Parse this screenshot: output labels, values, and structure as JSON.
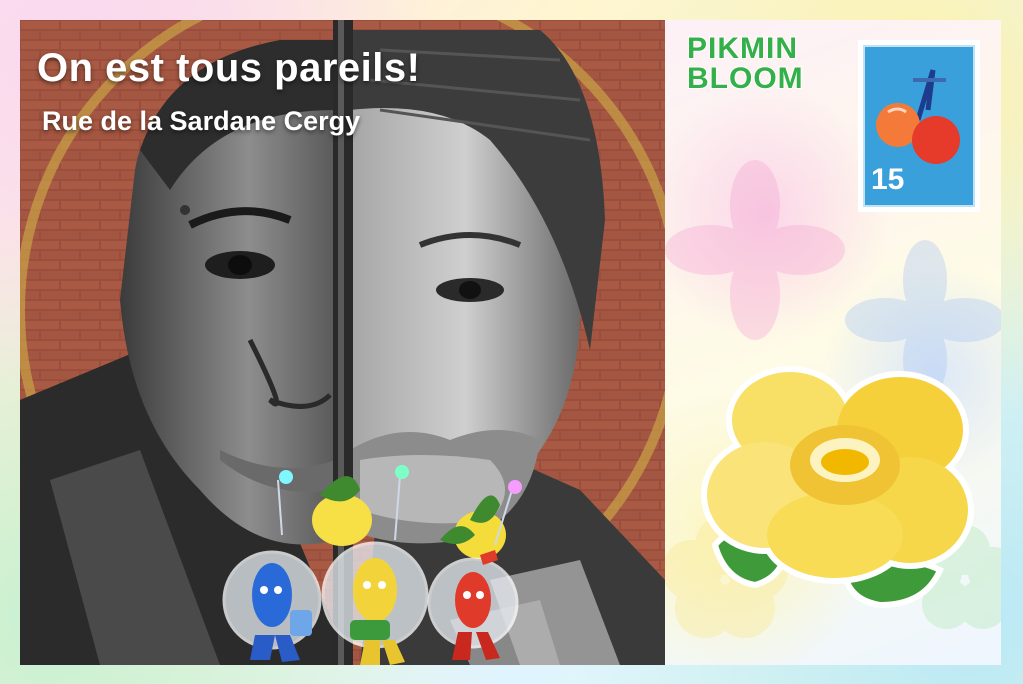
{
  "postcard": {
    "title": "On est tous pareils!",
    "location": "Rue de la Sardane Cergy"
  },
  "brand": {
    "line1": "PIKMIN",
    "line2": "BLOOM",
    "color": "#34b04a"
  },
  "stamp": {
    "number": "15",
    "icon": "cherries-icon",
    "color": "#3aa0dc"
  },
  "flower": {
    "icon": "yellow-rose-icon",
    "color": "#f5d03a"
  },
  "pikmin": [
    {
      "type": "blue",
      "color": "#2a6ad8"
    },
    {
      "type": "yellow",
      "color": "#f2d43a"
    },
    {
      "type": "red",
      "color": "#e03a2a"
    }
  ]
}
